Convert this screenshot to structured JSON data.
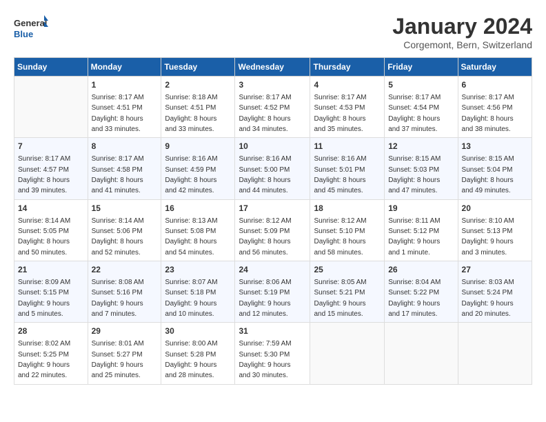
{
  "logo": {
    "line1": "General",
    "line2": "Blue"
  },
  "title": "January 2024",
  "location": "Corgemont, Bern, Switzerland",
  "days_of_week": [
    "Sunday",
    "Monday",
    "Tuesday",
    "Wednesday",
    "Thursday",
    "Friday",
    "Saturday"
  ],
  "weeks": [
    [
      {
        "day": "",
        "info": ""
      },
      {
        "day": "1",
        "info": "Sunrise: 8:17 AM\nSunset: 4:51 PM\nDaylight: 8 hours\nand 33 minutes."
      },
      {
        "day": "2",
        "info": "Sunrise: 8:18 AM\nSunset: 4:51 PM\nDaylight: 8 hours\nand 33 minutes."
      },
      {
        "day": "3",
        "info": "Sunrise: 8:17 AM\nSunset: 4:52 PM\nDaylight: 8 hours\nand 34 minutes."
      },
      {
        "day": "4",
        "info": "Sunrise: 8:17 AM\nSunset: 4:53 PM\nDaylight: 8 hours\nand 35 minutes."
      },
      {
        "day": "5",
        "info": "Sunrise: 8:17 AM\nSunset: 4:54 PM\nDaylight: 8 hours\nand 37 minutes."
      },
      {
        "day": "6",
        "info": "Sunrise: 8:17 AM\nSunset: 4:56 PM\nDaylight: 8 hours\nand 38 minutes."
      }
    ],
    [
      {
        "day": "7",
        "info": "Sunrise: 8:17 AM\nSunset: 4:57 PM\nDaylight: 8 hours\nand 39 minutes."
      },
      {
        "day": "8",
        "info": "Sunrise: 8:17 AM\nSunset: 4:58 PM\nDaylight: 8 hours\nand 41 minutes."
      },
      {
        "day": "9",
        "info": "Sunrise: 8:16 AM\nSunset: 4:59 PM\nDaylight: 8 hours\nand 42 minutes."
      },
      {
        "day": "10",
        "info": "Sunrise: 8:16 AM\nSunset: 5:00 PM\nDaylight: 8 hours\nand 44 minutes."
      },
      {
        "day": "11",
        "info": "Sunrise: 8:16 AM\nSunset: 5:01 PM\nDaylight: 8 hours\nand 45 minutes."
      },
      {
        "day": "12",
        "info": "Sunrise: 8:15 AM\nSunset: 5:03 PM\nDaylight: 8 hours\nand 47 minutes."
      },
      {
        "day": "13",
        "info": "Sunrise: 8:15 AM\nSunset: 5:04 PM\nDaylight: 8 hours\nand 49 minutes."
      }
    ],
    [
      {
        "day": "14",
        "info": "Sunrise: 8:14 AM\nSunset: 5:05 PM\nDaylight: 8 hours\nand 50 minutes."
      },
      {
        "day": "15",
        "info": "Sunrise: 8:14 AM\nSunset: 5:06 PM\nDaylight: 8 hours\nand 52 minutes."
      },
      {
        "day": "16",
        "info": "Sunrise: 8:13 AM\nSunset: 5:08 PM\nDaylight: 8 hours\nand 54 minutes."
      },
      {
        "day": "17",
        "info": "Sunrise: 8:12 AM\nSunset: 5:09 PM\nDaylight: 8 hours\nand 56 minutes."
      },
      {
        "day": "18",
        "info": "Sunrise: 8:12 AM\nSunset: 5:10 PM\nDaylight: 8 hours\nand 58 minutes."
      },
      {
        "day": "19",
        "info": "Sunrise: 8:11 AM\nSunset: 5:12 PM\nDaylight: 9 hours\nand 1 minute."
      },
      {
        "day": "20",
        "info": "Sunrise: 8:10 AM\nSunset: 5:13 PM\nDaylight: 9 hours\nand 3 minutes."
      }
    ],
    [
      {
        "day": "21",
        "info": "Sunrise: 8:09 AM\nSunset: 5:15 PM\nDaylight: 9 hours\nand 5 minutes."
      },
      {
        "day": "22",
        "info": "Sunrise: 8:08 AM\nSunset: 5:16 PM\nDaylight: 9 hours\nand 7 minutes."
      },
      {
        "day": "23",
        "info": "Sunrise: 8:07 AM\nSunset: 5:18 PM\nDaylight: 9 hours\nand 10 minutes."
      },
      {
        "day": "24",
        "info": "Sunrise: 8:06 AM\nSunset: 5:19 PM\nDaylight: 9 hours\nand 12 minutes."
      },
      {
        "day": "25",
        "info": "Sunrise: 8:05 AM\nSunset: 5:21 PM\nDaylight: 9 hours\nand 15 minutes."
      },
      {
        "day": "26",
        "info": "Sunrise: 8:04 AM\nSunset: 5:22 PM\nDaylight: 9 hours\nand 17 minutes."
      },
      {
        "day": "27",
        "info": "Sunrise: 8:03 AM\nSunset: 5:24 PM\nDaylight: 9 hours\nand 20 minutes."
      }
    ],
    [
      {
        "day": "28",
        "info": "Sunrise: 8:02 AM\nSunset: 5:25 PM\nDaylight: 9 hours\nand 22 minutes."
      },
      {
        "day": "29",
        "info": "Sunrise: 8:01 AM\nSunset: 5:27 PM\nDaylight: 9 hours\nand 25 minutes."
      },
      {
        "day": "30",
        "info": "Sunrise: 8:00 AM\nSunset: 5:28 PM\nDaylight: 9 hours\nand 28 minutes."
      },
      {
        "day": "31",
        "info": "Sunrise: 7:59 AM\nSunset: 5:30 PM\nDaylight: 9 hours\nand 30 minutes."
      },
      {
        "day": "",
        "info": ""
      },
      {
        "day": "",
        "info": ""
      },
      {
        "day": "",
        "info": ""
      }
    ]
  ]
}
